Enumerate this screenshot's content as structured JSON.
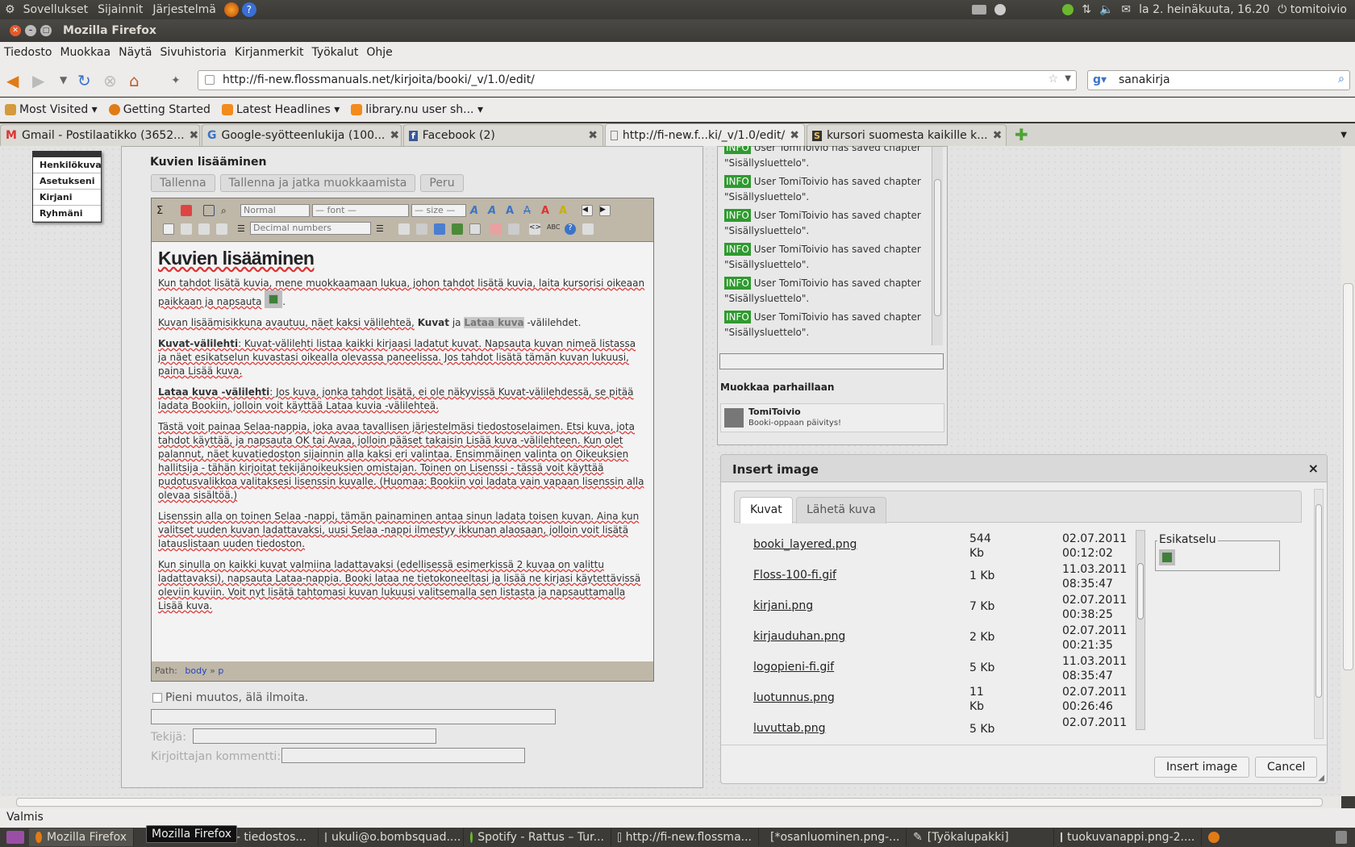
{
  "topbar": {
    "menus": [
      "Sovellukset",
      "Sijainnit",
      "Järjestelmä"
    ],
    "clock": "la  2. heinäkuuta, 16.20",
    "user": "tomitoivio"
  },
  "window": {
    "title": "Mozilla Firefox"
  },
  "menubar": [
    "Tiedosto",
    "Muokkaa",
    "Näytä",
    "Sivuhistoria",
    "Kirjanmerkit",
    "Työkalut",
    "Ohje"
  ],
  "nav": {
    "url": "http://fi-new.flossmanuals.net/kirjoita/booki/_v/1.0/edit/",
    "search": "sanakirja"
  },
  "bookmarks": [
    "Most Visited ▾",
    "Getting Started",
    "Latest Headlines ▾",
    "library.nu user sh... ▾"
  ],
  "tabs": [
    "Gmail - Postilaatikko (3652...",
    "Google-syötteenlukija (100...",
    "Facebook (2)",
    "http://fi-new.f...ki/_v/1.0/edit/",
    "kursori suomesta kaikille k..."
  ],
  "sidemenu": [
    "Henkilökuva",
    "Asetukseni",
    "Kirjani",
    "Ryhmäni"
  ],
  "editor": {
    "heading": "Kuvien lisääminen",
    "buttons": {
      "save": "Tallenna",
      "save_continue": "Tallenna ja jatka muokkaamista",
      "cancel": "Peru"
    },
    "toolbar": {
      "format": "Normal",
      "font": "— font —",
      "size": "— size —",
      "list": "Decimal numbers"
    },
    "title": "Kuvien lisääminen",
    "p1": "Kun tahdot lisätä kuvia, mene muokkaamaan lukua, johon tahdot lisätä kuvia, laita kursorisi oikeaan paikkaan ja napsauta",
    "p2a": "Kuvan lisäämisikkuna avautuu, näet kaksi välilehteä,",
    "p2b": "Kuvat",
    "p2c": "ja",
    "p2d": "Lataa kuva",
    "p2e": "-välilehdet.",
    "p3a": "Kuvat-välilehti",
    "p3b": ": Kuvat-välilehti listaa kaikki kirjaasi ladatut kuvat. Napsauta kuvan nimeä listassa ja näet esikatselun kuvastasi oikealla olevassa paneelissa. Jos tahdot lisätä tämän kuvan lukuusi, paina Lisää kuva.",
    "p4a": "Lataa kuva -välilehti",
    "p4b": ": Jos kuva, jonka tahdot lisätä, ei ole näkyvissä Kuvat-välilehdessä, se pitää ladata Bookiin, jolloin voit käyttää Lataa kuvia -välilehteä.",
    "p5": "Tästä voit painaa Selaa-nappia, joka avaa tavallisen järjestelmäsi tiedostoselaimen. Etsi kuva, jota tahdot käyttää, ja napsauta OK tai Avaa, jolloin pääset takaisin Lisää kuva -välilehteen. Kun olet palannut, näet kuvatiedoston sijainnin alla kaksi eri valintaa. Ensimmäinen valinta on Oikeuksien hallitsija - tähän kirjoitat tekijänoikeuksien omistajan. Toinen on Lisenssi - tässä voit käyttää pudotusvalikkoa valitaksesi lisenssin kuvalle. (Huomaa: Bookiin voi ladata vain vapaan lisenssin alla olevaa sisältöä.)",
    "p6": "Lisenssin alla on toinen Selaa -nappi, tämän painaminen antaa sinun ladata toisen kuvan. Aina kun valitset uuden kuvan ladattavaksi, uusi Selaa -nappi ilmestyy ikkunan alaosaan, jolloin voit lisätä latauslistaan uuden tiedoston.",
    "p7": "Kun sinulla on kaikki kuvat valmiina ladattavaksi (edellisessä esimerkissä 2 kuvaa on valittu ladattavaksi), napsauta Lataa-nappia. Booki lataa ne tietokoneeltasi ja lisää ne kirjasi käytettävissä oleviin kuviin. Voit nyt lisätä tahtomasi kuvan lukuusi valitsemalla sen listasta ja napsauttamalla Lisää kuva.",
    "path_label": "Path:",
    "path_body": "body",
    "path_sep": "»",
    "path_p": "p",
    "minor_change": "Pieni muutos, älä ilmoita.",
    "author_label": "Tekijä:",
    "comment_label": "Kirjoittajan kommentti:"
  },
  "chat": {
    "tag": "INFO",
    "first_partial": "User TomiToivio has saved chapter",
    "msg_line1": "User TomiToivio has saved chapter",
    "msg_line2": "\"Sisällysluettelo\".",
    "editing_now": "Muokkaa parhaillaan",
    "editor_name": "TomiToivio",
    "editor_note": "Booki-oppaan päivitys!"
  },
  "dialog": {
    "title": "Insert image",
    "close": "×",
    "tab_images": "Kuvat",
    "tab_upload": "Lähetä kuva",
    "preview_label": "Esikatselu",
    "files": [
      {
        "name": "booki_layered.png",
        "size1": "544",
        "size2": "Kb",
        "date": "02.07.2011",
        "time": "00:12:02"
      },
      {
        "name": "Floss-100-fi.gif",
        "size1": "1 Kb",
        "size2": "",
        "date": "11.03.2011",
        "time": "08:35:47"
      },
      {
        "name": "kirjani.png",
        "size1": "7 Kb",
        "size2": "",
        "date": "02.07.2011",
        "time": "00:38:25"
      },
      {
        "name": "kirjauduhan.png",
        "size1": "2 Kb",
        "size2": "",
        "date": "02.07.2011",
        "time": "00:21:35"
      },
      {
        "name": "logopieni-fi.gif",
        "size1": "5 Kb",
        "size2": "",
        "date": "11.03.2011",
        "time": "08:35:47"
      },
      {
        "name": "luotunnus.png",
        "size1": "11",
        "size2": "Kb",
        "date": "02.07.2011",
        "time": "00:26:46"
      },
      {
        "name": "luvuttab.png",
        "size1": "5 Kb",
        "size2": "",
        "date": "02.07.2011",
        "time": ""
      }
    ],
    "insert_btn": "Insert image",
    "cancel_btn": "Cancel"
  },
  "status": "Valmis",
  "tooltip": "Mozilla Firefox",
  "taskbar": [
    "Mozilla Firefox",
    "er - tiedostos...",
    "ukuli@o.bombsquad....",
    "Spotify - Rattus – Tur...",
    "http://fi-new.flossma...",
    "[*osanluominen.png-...",
    "[Työkalupakki]",
    "tuokuvanappi.png-2...."
  ]
}
